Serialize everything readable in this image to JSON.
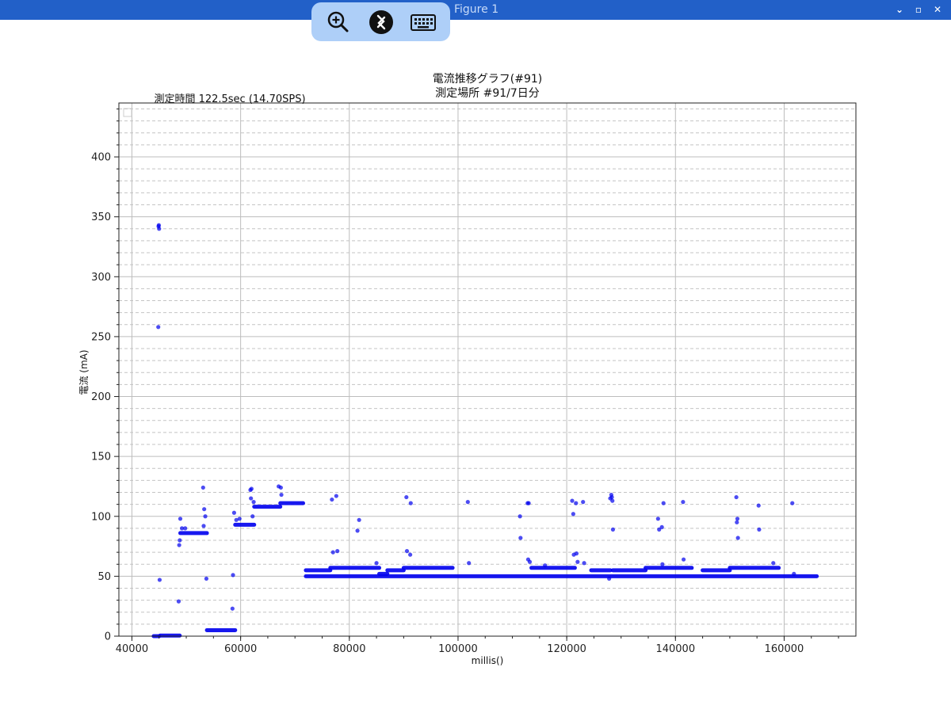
{
  "window": {
    "title": "Figure 1",
    "controls": [
      "⌄",
      "▫",
      "✕"
    ]
  },
  "toolbar": {
    "icons": [
      "zoom-in-icon",
      "remote-desktop-icon",
      "keyboard-icon"
    ]
  },
  "chart_data": {
    "type": "scatter",
    "title": "電流推移グラフ(#91)",
    "subtitle": "測定場所 #91/7日分",
    "annotation": "測定時間 122.5sec (14.70SPS)",
    "xlabel": "millis()",
    "ylabel": "電流 (mA)",
    "xlim": [
      37600,
      173200
    ],
    "ylim": [
      0,
      445
    ],
    "xticks": [
      40000,
      60000,
      80000,
      100000,
      120000,
      140000,
      160000
    ],
    "yticks": [
      0,
      50,
      100,
      150,
      200,
      250,
      300,
      350,
      400
    ],
    "grid": {
      "major": true,
      "minor": true
    },
    "series": [
      {
        "color": "#0000ee",
        "segments": [
          [
            44000,
            45000,
            0
          ],
          [
            45200,
            48800,
            0.5
          ],
          [
            48900,
            53800,
            86
          ],
          [
            53800,
            59000,
            5
          ],
          [
            59000,
            62500,
            93
          ],
          [
            62500,
            67300,
            108
          ],
          [
            67300,
            71500,
            111
          ],
          [
            72000,
            166000,
            50
          ],
          [
            72000,
            76500,
            55
          ],
          [
            76500,
            85500,
            57
          ],
          [
            85500,
            87000,
            52
          ],
          [
            87000,
            90000,
            55
          ],
          [
            90000,
            99000,
            57
          ],
          [
            113500,
            121500,
            57
          ],
          [
            124500,
            128000,
            55
          ],
          [
            128500,
            134500,
            55
          ],
          [
            134500,
            143000,
            57
          ],
          [
            145000,
            150000,
            55
          ],
          [
            150000,
            159000,
            57
          ]
        ],
        "points": [
          [
            44900,
            342
          ],
          [
            44950,
            343
          ],
          [
            45000,
            340
          ],
          [
            44850,
            258
          ],
          [
            45100,
            47
          ],
          [
            48900,
            98
          ],
          [
            48700,
            76
          ],
          [
            48800,
            80
          ],
          [
            48600,
            29
          ],
          [
            49200,
            90
          ],
          [
            49800,
            90
          ],
          [
            53100,
            124
          ],
          [
            53300,
            106
          ],
          [
            53500,
            100
          ],
          [
            53200,
            92
          ],
          [
            53700,
            48
          ],
          [
            58800,
            103
          ],
          [
            59200,
            97
          ],
          [
            59800,
            98
          ],
          [
            58600,
            51
          ],
          [
            58500,
            23
          ],
          [
            61800,
            122
          ],
          [
            62000,
            123
          ],
          [
            61900,
            115
          ],
          [
            62400,
            112
          ],
          [
            62200,
            100
          ],
          [
            67000,
            125
          ],
          [
            67400,
            124
          ],
          [
            67500,
            118
          ],
          [
            76800,
            114
          ],
          [
            77600,
            117
          ],
          [
            77000,
            70
          ],
          [
            77800,
            71
          ],
          [
            81500,
            88
          ],
          [
            81800,
            97
          ],
          [
            85000,
            61
          ],
          [
            90500,
            116
          ],
          [
            91300,
            111
          ],
          [
            90600,
            71
          ],
          [
            91200,
            68
          ],
          [
            101800,
            112
          ],
          [
            102000,
            61
          ],
          [
            111400,
            100
          ],
          [
            111500,
            82
          ],
          [
            112800,
            111
          ],
          [
            113000,
            111
          ],
          [
            112900,
            64
          ],
          [
            113200,
            62
          ],
          [
            116000,
            59
          ],
          [
            121000,
            113
          ],
          [
            121200,
            102
          ],
          [
            121700,
            111
          ],
          [
            121300,
            68
          ],
          [
            121800,
            69
          ],
          [
            122000,
            62
          ],
          [
            123000,
            112
          ],
          [
            123200,
            61
          ],
          [
            127800,
            48
          ],
          [
            128000,
            115
          ],
          [
            128200,
            118
          ],
          [
            128300,
            116
          ],
          [
            128400,
            113
          ],
          [
            128500,
            89
          ],
          [
            136800,
            98
          ],
          [
            137000,
            89
          ],
          [
            137800,
            111
          ],
          [
            137500,
            91
          ],
          [
            137600,
            60
          ],
          [
            141400,
            112
          ],
          [
            141500,
            64
          ],
          [
            151200,
            116
          ],
          [
            151400,
            98
          ],
          [
            151300,
            95
          ],
          [
            151500,
            82
          ],
          [
            155300,
            109
          ],
          [
            155400,
            89
          ],
          [
            158000,
            61
          ],
          [
            161500,
            111
          ],
          [
            161800,
            52
          ]
        ]
      }
    ]
  }
}
